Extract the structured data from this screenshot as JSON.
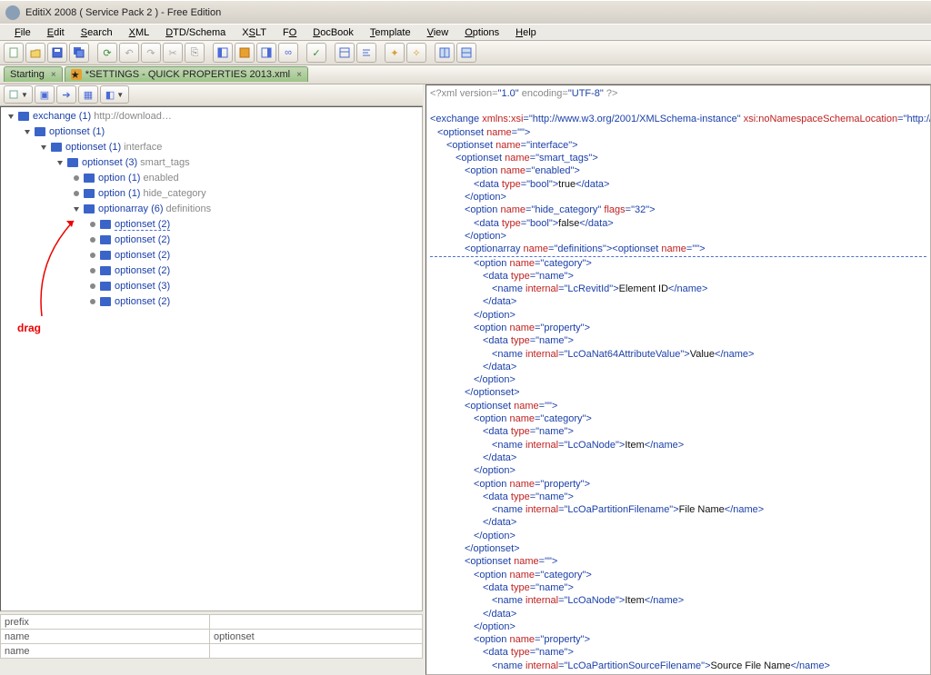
{
  "title": "EditiX 2008 ( Service Pack 2 ) - Free Edition",
  "menus": [
    "File",
    "Edit",
    "Search",
    "XML",
    "DTD/Schema",
    "XSLT",
    "FO",
    "DocBook",
    "Template",
    "View",
    "Options",
    "Help"
  ],
  "menu_underline_idx": [
    0,
    0,
    0,
    0,
    0,
    1,
    1,
    0,
    0,
    0,
    0,
    0
  ],
  "tabs": [
    {
      "label": "Starting",
      "star": false
    },
    {
      "label": "*SETTINGS - QUICK PROPERTIES 2013.xml",
      "star": true
    }
  ],
  "tree": [
    {
      "indent": 0,
      "toggle": "open",
      "label": "exchange",
      "count": "(1)",
      "hint": "http://download…"
    },
    {
      "indent": 1,
      "toggle": "open",
      "label": "optionset",
      "count": "(1)",
      "hint": ""
    },
    {
      "indent": 2,
      "toggle": "open",
      "label": "optionset",
      "count": "(1)",
      "hint": "interface"
    },
    {
      "indent": 3,
      "toggle": "open",
      "label": "optionset",
      "count": "(3)",
      "hint": "smart_tags"
    },
    {
      "indent": 4,
      "toggle": "leaf",
      "label": "option",
      "count": "(1)",
      "hint": "enabled"
    },
    {
      "indent": 4,
      "toggle": "leaf",
      "label": "option",
      "count": "(1)",
      "hint": "hide_category"
    },
    {
      "indent": 4,
      "toggle": "open",
      "label": "optionarray",
      "count": "(6)",
      "hint": "definitions"
    },
    {
      "indent": 5,
      "toggle": "leaf",
      "label": "optionset",
      "count": "(2)",
      "hint": "",
      "hl": true
    },
    {
      "indent": 5,
      "toggle": "leaf",
      "label": "optionset",
      "count": "(2)",
      "hint": ""
    },
    {
      "indent": 5,
      "toggle": "leaf",
      "label": "optionset",
      "count": "(2)",
      "hint": ""
    },
    {
      "indent": 5,
      "toggle": "leaf",
      "label": "optionset",
      "count": "(2)",
      "hint": ""
    },
    {
      "indent": 5,
      "toggle": "leaf",
      "label": "optionset",
      "count": "(3)",
      "hint": ""
    },
    {
      "indent": 5,
      "toggle": "leaf",
      "label": "optionset",
      "count": "(2)",
      "hint": ""
    }
  ],
  "annotation_drag": "drag",
  "bottom_rows": [
    [
      "prefix",
      ""
    ],
    [
      "name",
      "optionset"
    ],
    [
      "name",
      ""
    ]
  ],
  "xml": {
    "decl": {
      "p1": "<?xml version=",
      "v1": "\"1.0\"",
      "p2": " encoding=",
      "v2": "\"UTF-8\"",
      "p3": " ?>"
    },
    "lines": [
      {
        "ind": 0,
        "segs": [
          [
            "tag",
            "<exchange "
          ],
          [
            "attr",
            "xmlns:xsi"
          ],
          [
            "tag",
            "="
          ],
          [
            "val",
            "\"http://www.w3.org/2001/XMLSchema-instance\""
          ],
          [
            "attr",
            " xsi:noNamespaceSchemaLocation"
          ],
          [
            "tag",
            "="
          ],
          [
            "val",
            "\"http://"
          ]
        ]
      },
      {
        "ind": 1,
        "segs": [
          [
            "tag",
            "<optionset "
          ],
          [
            "attr",
            "name"
          ],
          [
            "tag",
            "="
          ],
          [
            "val",
            "\"\""
          ],
          [
            "tag",
            ">"
          ]
        ]
      },
      {
        "ind": 2,
        "segs": [
          [
            "tag",
            "<optionset "
          ],
          [
            "attr",
            "name"
          ],
          [
            "tag",
            "="
          ],
          [
            "val",
            "\"interface\""
          ],
          [
            "tag",
            ">"
          ]
        ]
      },
      {
        "ind": 3,
        "segs": [
          [
            "tag",
            "<optionset "
          ],
          [
            "attr",
            "name"
          ],
          [
            "tag",
            "="
          ],
          [
            "val",
            "\"smart_tags\""
          ],
          [
            "tag",
            ">"
          ]
        ]
      },
      {
        "ind": 4,
        "segs": [
          [
            "tag",
            "<option "
          ],
          [
            "attr",
            "name"
          ],
          [
            "tag",
            "="
          ],
          [
            "val",
            "\"enabled\""
          ],
          [
            "tag",
            ">"
          ]
        ]
      },
      {
        "ind": 5,
        "segs": [
          [
            "tag",
            "<data "
          ],
          [
            "attr",
            "type"
          ],
          [
            "tag",
            "="
          ],
          [
            "val",
            "\"bool\""
          ],
          [
            "tag",
            ">"
          ],
          [
            "text",
            "true"
          ],
          [
            "tag",
            "</data>"
          ]
        ]
      },
      {
        "ind": 4,
        "segs": [
          [
            "tag",
            "</option>"
          ]
        ]
      },
      {
        "ind": 4,
        "segs": [
          [
            "tag",
            "<option "
          ],
          [
            "attr",
            "name"
          ],
          [
            "tag",
            "="
          ],
          [
            "val",
            "\"hide_category\""
          ],
          [
            "attr",
            " flags"
          ],
          [
            "tag",
            "="
          ],
          [
            "val",
            "\"32\""
          ],
          [
            "tag",
            ">"
          ]
        ]
      },
      {
        "ind": 5,
        "segs": [
          [
            "tag",
            "<data "
          ],
          [
            "attr",
            "type"
          ],
          [
            "tag",
            "="
          ],
          [
            "val",
            "\"bool\""
          ],
          [
            "tag",
            ">"
          ],
          [
            "text",
            "false"
          ],
          [
            "tag",
            "</data>"
          ]
        ]
      },
      {
        "ind": 4,
        "segs": [
          [
            "tag",
            "</option>"
          ]
        ]
      },
      {
        "ind": 4,
        "hl": true,
        "segs": [
          [
            "tag",
            "<optionarray "
          ],
          [
            "attr",
            "name"
          ],
          [
            "tag",
            "="
          ],
          [
            "val",
            "\"definitions\""
          ],
          [
            "tag",
            ">"
          ],
          [
            "tag",
            "<optionset "
          ],
          [
            "attr",
            "name"
          ],
          [
            "tag",
            "="
          ],
          [
            "val",
            "\"\""
          ],
          [
            "tag",
            ">"
          ]
        ]
      },
      {
        "ind": 5,
        "segs": [
          [
            "tag",
            "<option "
          ],
          [
            "attr",
            "name"
          ],
          [
            "tag",
            "="
          ],
          [
            "val",
            "\"category\""
          ],
          [
            "tag",
            ">"
          ]
        ]
      },
      {
        "ind": 6,
        "segs": [
          [
            "tag",
            "<data "
          ],
          [
            "attr",
            "type"
          ],
          [
            "tag",
            "="
          ],
          [
            "val",
            "\"name\""
          ],
          [
            "tag",
            ">"
          ]
        ]
      },
      {
        "ind": 7,
        "segs": [
          [
            "tag",
            "<name "
          ],
          [
            "attr",
            "internal"
          ],
          [
            "tag",
            "="
          ],
          [
            "val",
            "\"LcRevitId\""
          ],
          [
            "tag",
            ">"
          ],
          [
            "text",
            "Element ID"
          ],
          [
            "tag",
            "</name>"
          ]
        ]
      },
      {
        "ind": 6,
        "segs": [
          [
            "tag",
            "</data>"
          ]
        ]
      },
      {
        "ind": 5,
        "segs": [
          [
            "tag",
            "</option>"
          ]
        ]
      },
      {
        "ind": 5,
        "segs": [
          [
            "tag",
            "<option "
          ],
          [
            "attr",
            "name"
          ],
          [
            "tag",
            "="
          ],
          [
            "val",
            "\"property\""
          ],
          [
            "tag",
            ">"
          ]
        ]
      },
      {
        "ind": 6,
        "segs": [
          [
            "tag",
            "<data "
          ],
          [
            "attr",
            "type"
          ],
          [
            "tag",
            "="
          ],
          [
            "val",
            "\"name\""
          ],
          [
            "tag",
            ">"
          ]
        ]
      },
      {
        "ind": 7,
        "segs": [
          [
            "tag",
            "<name "
          ],
          [
            "attr",
            "internal"
          ],
          [
            "tag",
            "="
          ],
          [
            "val",
            "\"LcOaNat64AttributeValue\""
          ],
          [
            "tag",
            ">"
          ],
          [
            "text",
            "Value"
          ],
          [
            "tag",
            "</name>"
          ]
        ]
      },
      {
        "ind": 6,
        "segs": [
          [
            "tag",
            "</data>"
          ]
        ]
      },
      {
        "ind": 5,
        "segs": [
          [
            "tag",
            "</option>"
          ]
        ]
      },
      {
        "ind": 4,
        "segs": [
          [
            "tag",
            "</optionset>"
          ]
        ]
      },
      {
        "ind": 4,
        "segs": [
          [
            "tag",
            "<optionset "
          ],
          [
            "attr",
            "name"
          ],
          [
            "tag",
            "="
          ],
          [
            "val",
            "\"\""
          ],
          [
            "tag",
            ">"
          ]
        ]
      },
      {
        "ind": 5,
        "segs": [
          [
            "tag",
            "<option "
          ],
          [
            "attr",
            "name"
          ],
          [
            "tag",
            "="
          ],
          [
            "val",
            "\"category\""
          ],
          [
            "tag",
            ">"
          ]
        ]
      },
      {
        "ind": 6,
        "segs": [
          [
            "tag",
            "<data "
          ],
          [
            "attr",
            "type"
          ],
          [
            "tag",
            "="
          ],
          [
            "val",
            "\"name\""
          ],
          [
            "tag",
            ">"
          ]
        ]
      },
      {
        "ind": 7,
        "segs": [
          [
            "tag",
            "<name "
          ],
          [
            "attr",
            "internal"
          ],
          [
            "tag",
            "="
          ],
          [
            "val",
            "\"LcOaNode\""
          ],
          [
            "tag",
            ">"
          ],
          [
            "text",
            "Item"
          ],
          [
            "tag",
            "</name>"
          ]
        ]
      },
      {
        "ind": 6,
        "segs": [
          [
            "tag",
            "</data>"
          ]
        ]
      },
      {
        "ind": 5,
        "segs": [
          [
            "tag",
            "</option>"
          ]
        ]
      },
      {
        "ind": 5,
        "segs": [
          [
            "tag",
            "<option "
          ],
          [
            "attr",
            "name"
          ],
          [
            "tag",
            "="
          ],
          [
            "val",
            "\"property\""
          ],
          [
            "tag",
            ">"
          ]
        ]
      },
      {
        "ind": 6,
        "segs": [
          [
            "tag",
            "<data "
          ],
          [
            "attr",
            "type"
          ],
          [
            "tag",
            "="
          ],
          [
            "val",
            "\"name\""
          ],
          [
            "tag",
            ">"
          ]
        ]
      },
      {
        "ind": 7,
        "segs": [
          [
            "tag",
            "<name "
          ],
          [
            "attr",
            "internal"
          ],
          [
            "tag",
            "="
          ],
          [
            "val",
            "\"LcOaPartitionFilename\""
          ],
          [
            "tag",
            ">"
          ],
          [
            "text",
            "File Name"
          ],
          [
            "tag",
            "</name>"
          ]
        ]
      },
      {
        "ind": 6,
        "segs": [
          [
            "tag",
            "</data>"
          ]
        ]
      },
      {
        "ind": 5,
        "segs": [
          [
            "tag",
            "</option>"
          ]
        ]
      },
      {
        "ind": 4,
        "segs": [
          [
            "tag",
            "</optionset>"
          ]
        ]
      },
      {
        "ind": 4,
        "segs": [
          [
            "tag",
            "<optionset "
          ],
          [
            "attr",
            "name"
          ],
          [
            "tag",
            "="
          ],
          [
            "val",
            "\"\""
          ],
          [
            "tag",
            ">"
          ]
        ]
      },
      {
        "ind": 5,
        "segs": [
          [
            "tag",
            "<option "
          ],
          [
            "attr",
            "name"
          ],
          [
            "tag",
            "="
          ],
          [
            "val",
            "\"category\""
          ],
          [
            "tag",
            ">"
          ]
        ]
      },
      {
        "ind": 6,
        "segs": [
          [
            "tag",
            "<data "
          ],
          [
            "attr",
            "type"
          ],
          [
            "tag",
            "="
          ],
          [
            "val",
            "\"name\""
          ],
          [
            "tag",
            ">"
          ]
        ]
      },
      {
        "ind": 7,
        "segs": [
          [
            "tag",
            "<name "
          ],
          [
            "attr",
            "internal"
          ],
          [
            "tag",
            "="
          ],
          [
            "val",
            "\"LcOaNode\""
          ],
          [
            "tag",
            ">"
          ],
          [
            "text",
            "Item"
          ],
          [
            "tag",
            "</name>"
          ]
        ]
      },
      {
        "ind": 6,
        "segs": [
          [
            "tag",
            "</data>"
          ]
        ]
      },
      {
        "ind": 5,
        "segs": [
          [
            "tag",
            "</option>"
          ]
        ]
      },
      {
        "ind": 5,
        "segs": [
          [
            "tag",
            "<option "
          ],
          [
            "attr",
            "name"
          ],
          [
            "tag",
            "="
          ],
          [
            "val",
            "\"property\""
          ],
          [
            "tag",
            ">"
          ]
        ]
      },
      {
        "ind": 6,
        "segs": [
          [
            "tag",
            "<data "
          ],
          [
            "attr",
            "type"
          ],
          [
            "tag",
            "="
          ],
          [
            "val",
            "\"name\""
          ],
          [
            "tag",
            ">"
          ]
        ]
      },
      {
        "ind": 7,
        "segs": [
          [
            "tag",
            "<name "
          ],
          [
            "attr",
            "internal"
          ],
          [
            "tag",
            "="
          ],
          [
            "val",
            "\"LcOaPartitionSourceFilename\""
          ],
          [
            "tag",
            ">"
          ],
          [
            "text",
            "Source File Name"
          ],
          [
            "tag",
            "</name>"
          ]
        ]
      }
    ]
  }
}
